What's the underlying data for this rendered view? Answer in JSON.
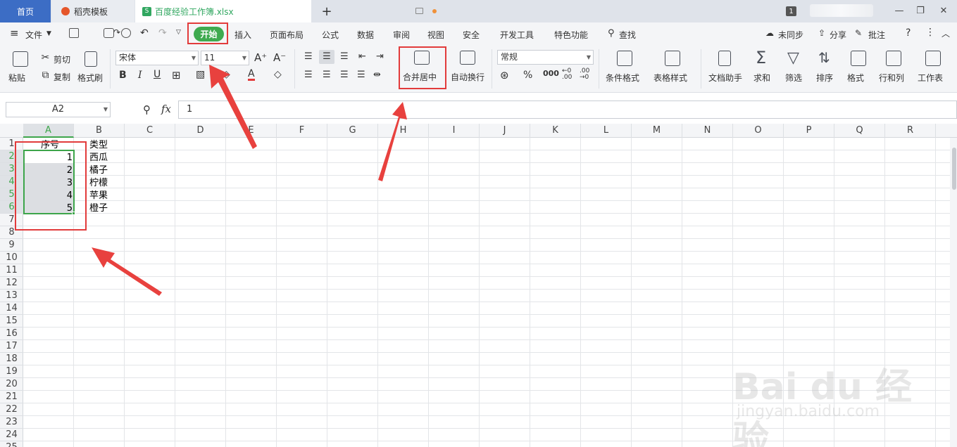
{
  "tabs": {
    "home": "首页",
    "template": "稻壳模板",
    "file": "百度经验工作簿.xlsx",
    "add": "+"
  },
  "window": {
    "count": "1"
  },
  "menu": {
    "file": "文件",
    "start": "开始",
    "items": [
      "插入",
      "页面布局",
      "公式",
      "数据",
      "审阅",
      "视图",
      "安全",
      "开发工具",
      "特色功能"
    ],
    "search": "查找",
    "sync": "未同步",
    "share": "分享",
    "comment": "批注"
  },
  "ribbon": {
    "paste": "粘贴",
    "cut": "剪切",
    "copy": "复制",
    "format_painter": "格式刷",
    "font": "宋体",
    "font_size": "11",
    "merge_center": "合并居中",
    "wrap": "自动换行",
    "number_format": "常规",
    "cond_format": "条件格式",
    "table_style": "表格样式",
    "doc_helper": "文档助手",
    "sum": "求和",
    "filter": "筛选",
    "sort": "排序",
    "format": "格式",
    "rows_cols": "行和列",
    "worksheet": "工作表"
  },
  "formula_bar": {
    "name_box": "A2",
    "fx": "fx",
    "value": "1"
  },
  "columns": [
    "A",
    "B",
    "C",
    "D",
    "E",
    "F",
    "G",
    "H",
    "I",
    "J",
    "K",
    "L",
    "M",
    "N",
    "O",
    "P",
    "Q",
    "R"
  ],
  "rows": [
    "1",
    "2",
    "3",
    "4",
    "5",
    "6",
    "7",
    "8",
    "9",
    "10",
    "11",
    "12",
    "13",
    "14",
    "15",
    "16",
    "17",
    "18",
    "19",
    "20",
    "21",
    "22",
    "23",
    "24",
    "25"
  ],
  "sheet": {
    "a1": "序号",
    "b1": "类型",
    "a_values": [
      "1",
      "2",
      "3",
      "4",
      "5"
    ],
    "b_values": [
      "西瓜",
      "橘子",
      "柠檬",
      "苹果",
      "橙子"
    ]
  },
  "watermark": {
    "brand": "Bai du 经验",
    "url": "jingyan.baidu.com"
  },
  "colors": {
    "accent_green": "#3faa4f",
    "home_tab": "#3c6dc5",
    "annotation_red": "#e23b3b"
  }
}
